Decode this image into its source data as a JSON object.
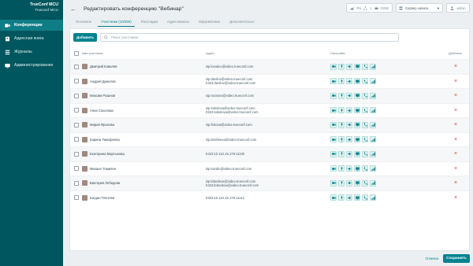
{
  "brand": {
    "title": "TrueConf MCU",
    "subtitle": "Trueconf MCU"
  },
  "sidebar": {
    "items": [
      {
        "label": "Конференции",
        "icon": "conference-icon",
        "active": true
      },
      {
        "label": "Адресная книга",
        "icon": "address-book-icon",
        "active": false
      },
      {
        "label": "Журналы",
        "icon": "logs-icon",
        "active": false
      },
      {
        "label": "Администрирование",
        "icon": "admin-icon",
        "active": false
      }
    ]
  },
  "header": {
    "title": "Редактировать конференцию \"Вебинар\"",
    "stats": {
      "cpu": "0%",
      "net": "1",
      "ports": "0/250"
    },
    "server_select": "Сервер записи",
    "user": "admin"
  },
  "tabs": [
    {
      "label": "Основное",
      "active": false
    },
    {
      "label": "Участники (10/250)",
      "active": true
    },
    {
      "label": "Раскладки",
      "active": false
    },
    {
      "label": "Адресованны",
      "active": false
    },
    {
      "label": "Оформление",
      "active": false
    },
    {
      "label": "Дополнительно",
      "active": false
    }
  ],
  "toolbar": {
    "add_label": "Добавить",
    "search_placeholder": "Поиск участников"
  },
  "table": {
    "headers": {
      "name": "Имя участника",
      "address": "Адрес",
      "settings": "Настройки",
      "actions": "Действия"
    },
    "rows": [
      {
        "name": "Дмитрий Ковалёв",
        "address": [
          "sip:kovalev@video.trueconf.com"
        ]
      },
      {
        "name": "Андрей Данилов",
        "address": [
          "sip:danilov@video.trueconf.com",
          "h323:danilov@video.trueconf.com"
        ]
      },
      {
        "name": "Максим Розанов",
        "address": [
          "sip:rozanov@video.trueconf.com"
        ]
      },
      {
        "name": "Анна Соколова",
        "address": [
          "sip:sokolova@video.trueconf.com",
          "h323:sokolova@video.trueconf.com"
        ]
      },
      {
        "name": "Мария Фролова",
        "address": [
          "sip:frolova@video.trueconf.com"
        ]
      },
      {
        "name": "Карина Тимофеева",
        "address": [
          "sip:timofeeva@video.trueconf.com"
        ]
      },
      {
        "name": "Екатерина Мартынова",
        "address": [
          "h323:10.110.15.178:11100"
        ]
      },
      {
        "name": "Михаил Томилин",
        "address": [
          "sip:tomilin@video.trueconf.com"
        ]
      },
      {
        "name": "Виктория Лебедева",
        "address": [
          "sip:lebedeva@video.trueconf.com",
          "h323:lebedeva@video.trueconf.com"
        ]
      },
      {
        "name": "Богдан Плетнёв",
        "address": [
          "h323:10.110.15.178:11112"
        ]
      }
    ],
    "setting_icons": [
      "camera-icon",
      "microphone-icon",
      "speaker-icon",
      "screen-share-icon",
      "phone-icon",
      "signal-icon"
    ]
  },
  "footer": {
    "cancel_label": "Отмена",
    "save_label": "Сохранить"
  },
  "colors": {
    "sidebar": "#00565e",
    "accent": "#00838f",
    "delete": "#e53935"
  }
}
